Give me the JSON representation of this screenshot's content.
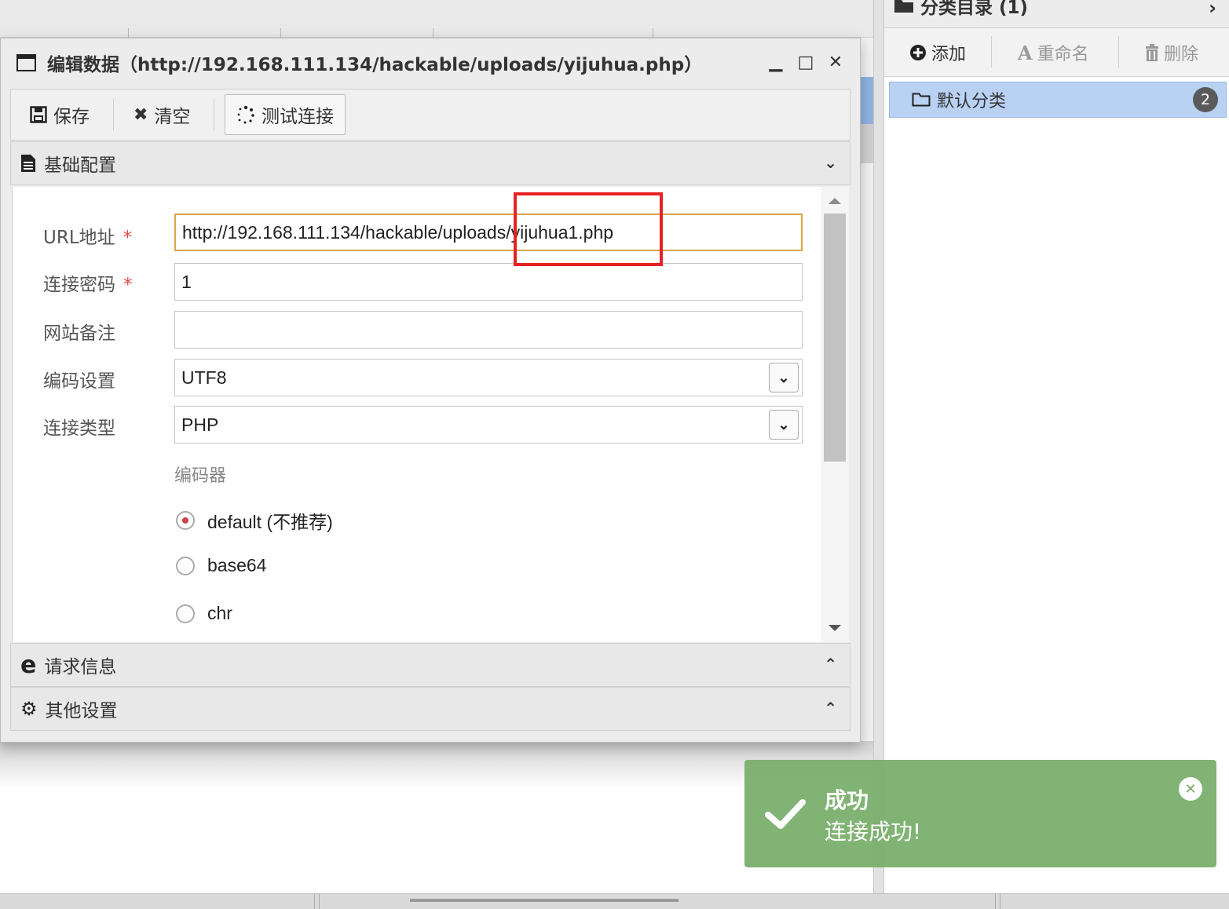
{
  "dialog": {
    "title": "编辑数据（http://192.168.111.134/hackable/uploads/yijuhua.php）",
    "toolbar": {
      "save_label": "保存",
      "clear_label": "清空",
      "test_label": "测试连接"
    },
    "sections": {
      "basic": "基础配置",
      "request": "请求信息",
      "other": "其他设置"
    },
    "form": {
      "url_label": "URL地址",
      "url_value": "http://192.168.111.134/hackable/uploads/yijuhua1.php",
      "password_label": "连接密码",
      "password_value": "1",
      "note_label": "网站备注",
      "note_value": "",
      "encoding_label": "编码设置",
      "encoding_value": "UTF8",
      "type_label": "连接类型",
      "type_value": "PHP",
      "required_mark": "*",
      "encoder_label": "编码器",
      "encoders": [
        "default (不推荐)",
        "base64",
        "chr"
      ],
      "selected_encoder": "default (不推荐)"
    }
  },
  "right_panel": {
    "title": "分类目录 (1)",
    "add_label": "添加",
    "rename_label": "重命名",
    "delete_label": "删除",
    "category_label": "默认分类",
    "category_count": "2"
  },
  "toast": {
    "title": "成功",
    "message": "连接成功!"
  },
  "colors": {
    "toast_bg": "#76ac68",
    "selected_bg": "#b9d1f3",
    "highlight_red": "#e62222",
    "focus_border": "#d6a64a"
  }
}
